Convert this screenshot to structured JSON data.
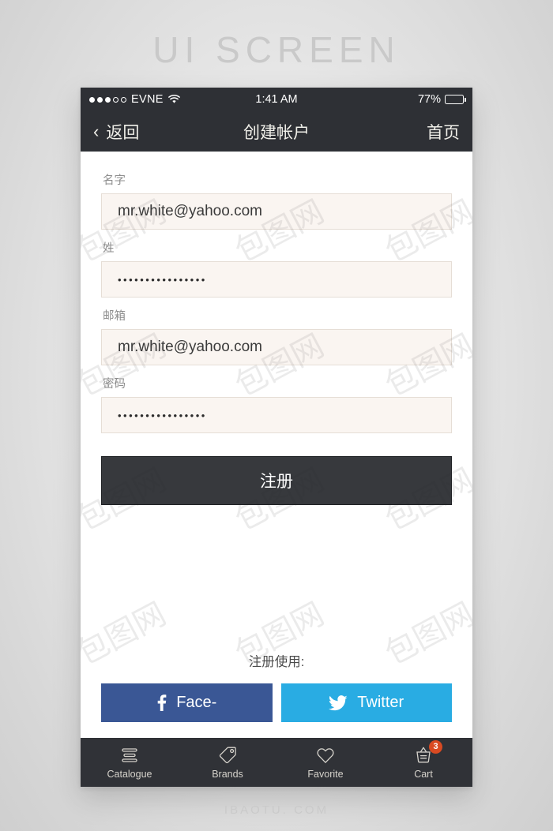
{
  "poster": {
    "title": "UI SCREEN",
    "footer": "IBAOTU. COM",
    "watermark": "包图网"
  },
  "status_bar": {
    "carrier": "EVNE",
    "signal_total": 5,
    "signal_filled": 3,
    "wifi_icon": "wifi-icon",
    "time": "1:41 AM",
    "battery_percent": "77%",
    "battery_level": 77
  },
  "nav_bar": {
    "back_icon": "chevron-left-icon",
    "back_label": "返回",
    "title": "创建帐户",
    "home_label": "首页"
  },
  "form": {
    "fields": [
      {
        "label": "名字",
        "value": "mr.white@yahoo.com",
        "type": "text"
      },
      {
        "label": "姓",
        "value": "••••••••••••••••",
        "type": "password"
      },
      {
        "label": "邮箱",
        "value": "mr.white@yahoo.com",
        "type": "text"
      },
      {
        "label": "密码",
        "value": "••••••••••••••••",
        "type": "password"
      }
    ],
    "submit_label": "注册"
  },
  "social": {
    "label": "注册使用:",
    "buttons": [
      {
        "name": "facebook",
        "label": "Face-",
        "icon": "facebook-icon",
        "glyph": "f",
        "color": "#3a5795"
      },
      {
        "name": "twitter",
        "label": "Twitter",
        "icon": "twitter-icon",
        "glyph": "🐦",
        "color": "#29ace3"
      }
    ]
  },
  "tab_bar": {
    "items": [
      {
        "label": "Catalogue",
        "icon": "list-lines-icon",
        "badge": ""
      },
      {
        "label": "Brands",
        "icon": "price-tag-icon",
        "badge": ""
      },
      {
        "label": "Favorite",
        "icon": "heart-icon",
        "badge": ""
      },
      {
        "label": "Cart",
        "icon": "shopping-basket-icon",
        "badge": "3"
      }
    ]
  },
  "colors": {
    "chrome_dark": "#2e3035",
    "tab_dark": "#303237",
    "field_bg": "#faf5f1",
    "field_border": "#e6ded6",
    "badge_red": "#d94a22"
  }
}
